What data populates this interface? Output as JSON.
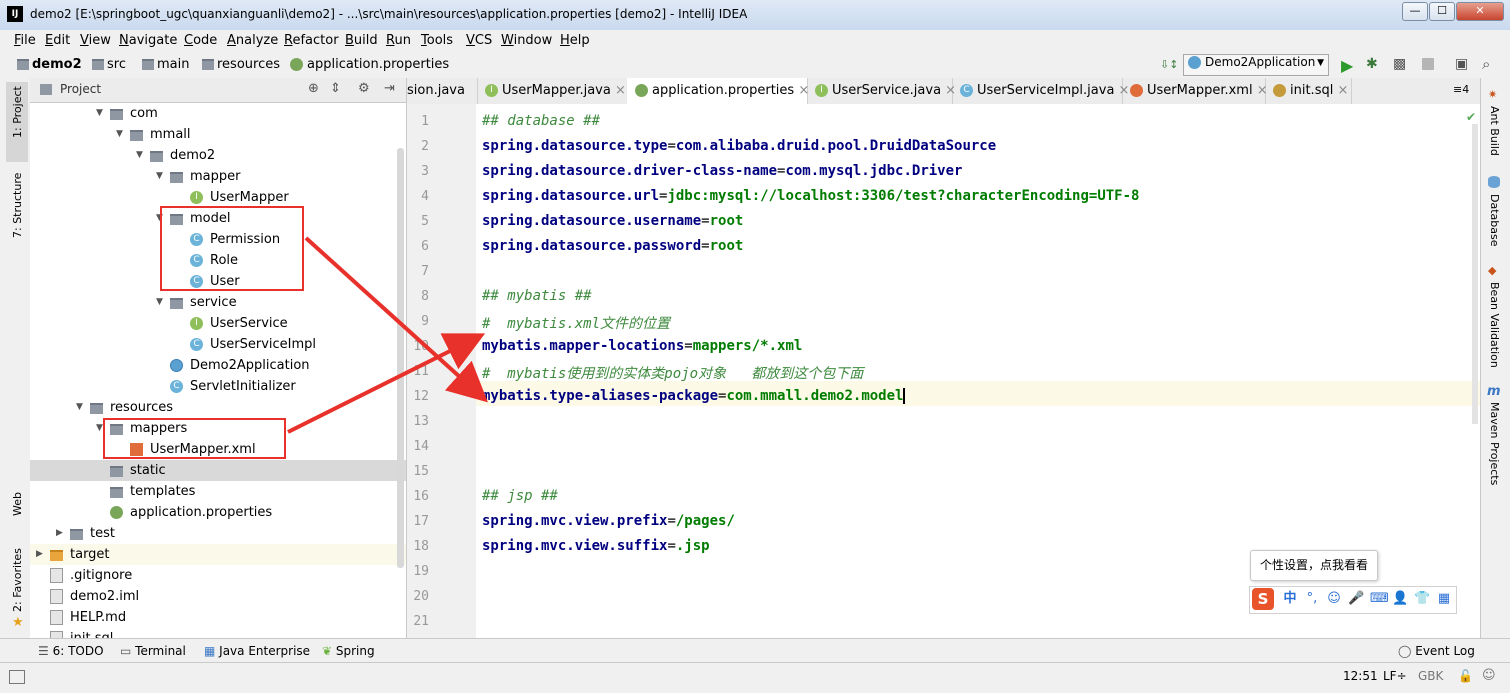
{
  "window": {
    "title": "demo2 [E:\\springboot_ugc\\quanxianguanli\\demo2] - ...\\src\\main\\resources\\application.properties [demo2] - IntelliJ IDEA",
    "app_icon": "IJ",
    "minimize": "—",
    "maximize": "☐",
    "close": "✕"
  },
  "menu": [
    "File",
    "Edit",
    "View",
    "Navigate",
    "Code",
    "Analyze",
    "Refactor",
    "Build",
    "Run",
    "Tools",
    "VCS",
    "Window",
    "Help"
  ],
  "breadcrumb": [
    "demo2",
    "src",
    "main",
    "resources",
    "application.properties"
  ],
  "run_config": "Demo2Application",
  "left_stripe": [
    "1: Project",
    "7: Structure",
    "Web",
    "2: Favorites"
  ],
  "project_panel": {
    "title": "Project",
    "tree": [
      {
        "label": "com",
        "indent": 4,
        "icon": "folder",
        "twisty": "v"
      },
      {
        "label": "mmall",
        "indent": 5,
        "icon": "folder",
        "twisty": "v"
      },
      {
        "label": "demo2",
        "indent": 6,
        "icon": "folder",
        "twisty": "v"
      },
      {
        "label": "mapper",
        "indent": 7,
        "icon": "folder",
        "twisty": "v"
      },
      {
        "label": "UserMapper",
        "indent": 8,
        "icon": "interface",
        "twisty": ""
      },
      {
        "label": "model",
        "indent": 7,
        "icon": "folder",
        "twisty": "v"
      },
      {
        "label": "Permission",
        "indent": 8,
        "icon": "class",
        "twisty": ""
      },
      {
        "label": "Role",
        "indent": 8,
        "icon": "class",
        "twisty": ""
      },
      {
        "label": "User",
        "indent": 8,
        "icon": "class",
        "twisty": ""
      },
      {
        "label": "service",
        "indent": 7,
        "icon": "folder",
        "twisty": "v"
      },
      {
        "label": "UserService",
        "indent": 8,
        "icon": "interface",
        "twisty": ""
      },
      {
        "label": "UserServiceImpl",
        "indent": 8,
        "icon": "class",
        "twisty": ""
      },
      {
        "label": "Demo2Application",
        "indent": 7,
        "icon": "app",
        "twisty": ""
      },
      {
        "label": "ServletInitializer",
        "indent": 7,
        "icon": "class",
        "twisty": ""
      },
      {
        "label": "resources",
        "indent": 3,
        "icon": "folder",
        "twisty": "v"
      },
      {
        "label": "mappers",
        "indent": 4,
        "icon": "folder",
        "twisty": "v"
      },
      {
        "label": "UserMapper.xml",
        "indent": 5,
        "icon": "xml",
        "twisty": ""
      },
      {
        "label": "static",
        "indent": 4,
        "icon": "folder",
        "twisty": "",
        "state": "selected"
      },
      {
        "label": "templates",
        "indent": 4,
        "icon": "folder",
        "twisty": ""
      },
      {
        "label": "application.properties",
        "indent": 4,
        "icon": "props",
        "twisty": ""
      },
      {
        "label": "test",
        "indent": 2,
        "icon": "folder",
        "twisty": ">"
      },
      {
        "label": "target",
        "indent": 1,
        "icon": "folder-orange",
        "twisty": ">",
        "state": "highlight"
      },
      {
        "label": ".gitignore",
        "indent": 1,
        "icon": "file",
        "twisty": ""
      },
      {
        "label": "demo2.iml",
        "indent": 1,
        "icon": "file",
        "twisty": ""
      },
      {
        "label": "HELP.md",
        "indent": 1,
        "icon": "file",
        "twisty": ""
      },
      {
        "label": "init.sql",
        "indent": 1,
        "icon": "file",
        "twisty": ""
      }
    ]
  },
  "editor_tabs": [
    {
      "label": "sion.java",
      "icon": "class",
      "active": false
    },
    {
      "label": "UserMapper.java",
      "icon": "interface",
      "active": false
    },
    {
      "label": "application.properties",
      "icon": "props",
      "active": true
    },
    {
      "label": "UserService.java",
      "icon": "interface",
      "active": false
    },
    {
      "label": "UserServiceImpl.java",
      "icon": "class",
      "active": false
    },
    {
      "label": "UserMapper.xml",
      "icon": "xml",
      "active": false
    },
    {
      "label": "init.sql",
      "icon": "sql",
      "active": false
    }
  ],
  "tab_overflow": "≡4",
  "code_lines": [
    [
      {
        "t": "## database ##",
        "c": "cm"
      }
    ],
    [
      {
        "t": "spring.datasource.type",
        "c": "key"
      },
      {
        "t": "=",
        "c": ""
      },
      {
        "t": "com.alibaba.druid.pool.DruidDataSource",
        "c": "key"
      }
    ],
    [
      {
        "t": "spring.datasource.driver-class-name",
        "c": "key"
      },
      {
        "t": "=",
        "c": ""
      },
      {
        "t": "com.mysql.jdbc.Driver",
        "c": "key"
      }
    ],
    [
      {
        "t": "spring.datasource.url",
        "c": "key"
      },
      {
        "t": "=",
        "c": ""
      },
      {
        "t": "jdbc:mysql://localhost:3306/test?characterEncoding=UTF-8",
        "c": "val"
      }
    ],
    [
      {
        "t": "spring.datasource.username",
        "c": "key"
      },
      {
        "t": "=",
        "c": ""
      },
      {
        "t": "root",
        "c": "val"
      }
    ],
    [
      {
        "t": "spring.datasource.password",
        "c": "key"
      },
      {
        "t": "=",
        "c": ""
      },
      {
        "t": "root",
        "c": "val"
      }
    ],
    [],
    [
      {
        "t": "## mybatis ##",
        "c": "cm"
      }
    ],
    [
      {
        "t": "#  mybatis.xml文件的位置",
        "c": "cm"
      }
    ],
    [
      {
        "t": "mybatis.mapper-locations",
        "c": "key"
      },
      {
        "t": "=",
        "c": ""
      },
      {
        "t": "mappers/*.xml",
        "c": "val"
      }
    ],
    [
      {
        "t": "#  mybatis使用到的实体类pojo对象   都放到这个包下面",
        "c": "cm"
      }
    ],
    [
      {
        "t": "mybatis.type-aliases-package",
        "c": "key"
      },
      {
        "t": "=",
        "c": ""
      },
      {
        "t": "com.mmall.demo2.model",
        "c": "val"
      }
    ],
    [],
    [],
    [],
    [
      {
        "t": "## jsp ##",
        "c": "cm"
      }
    ],
    [
      {
        "t": "spring.mvc.view.prefix",
        "c": "key"
      },
      {
        "t": "=",
        "c": ""
      },
      {
        "t": "/pages/",
        "c": "val"
      }
    ],
    [
      {
        "t": "spring.mvc.view.suffix",
        "c": "key"
      },
      {
        "t": "=",
        "c": ""
      },
      {
        "t": ".jsp",
        "c": "val"
      }
    ],
    [],
    [],
    []
  ],
  "right_stripe": [
    "Ant Build",
    "Database",
    "Bean Validation",
    "Maven Projects"
  ],
  "bottom_tools": [
    "6: TODO",
    "Terminal",
    "Java Enterprise",
    "Spring"
  ],
  "event_log": "Event Log",
  "status": {
    "position": "12:51",
    "line_sep": "LF÷",
    "encoding": "GBK"
  },
  "ime": {
    "tooltip": "个性设置，点我看看",
    "logo": "S",
    "lang": "中",
    "items": [
      "°,",
      "☺",
      "🎤",
      "⌨",
      "👤",
      "👕",
      "▦"
    ]
  },
  "colors": {
    "annotation": "#e8312a",
    "keyword": "#000080",
    "value": "#007c00",
    "comment": "#3e8a3e"
  }
}
